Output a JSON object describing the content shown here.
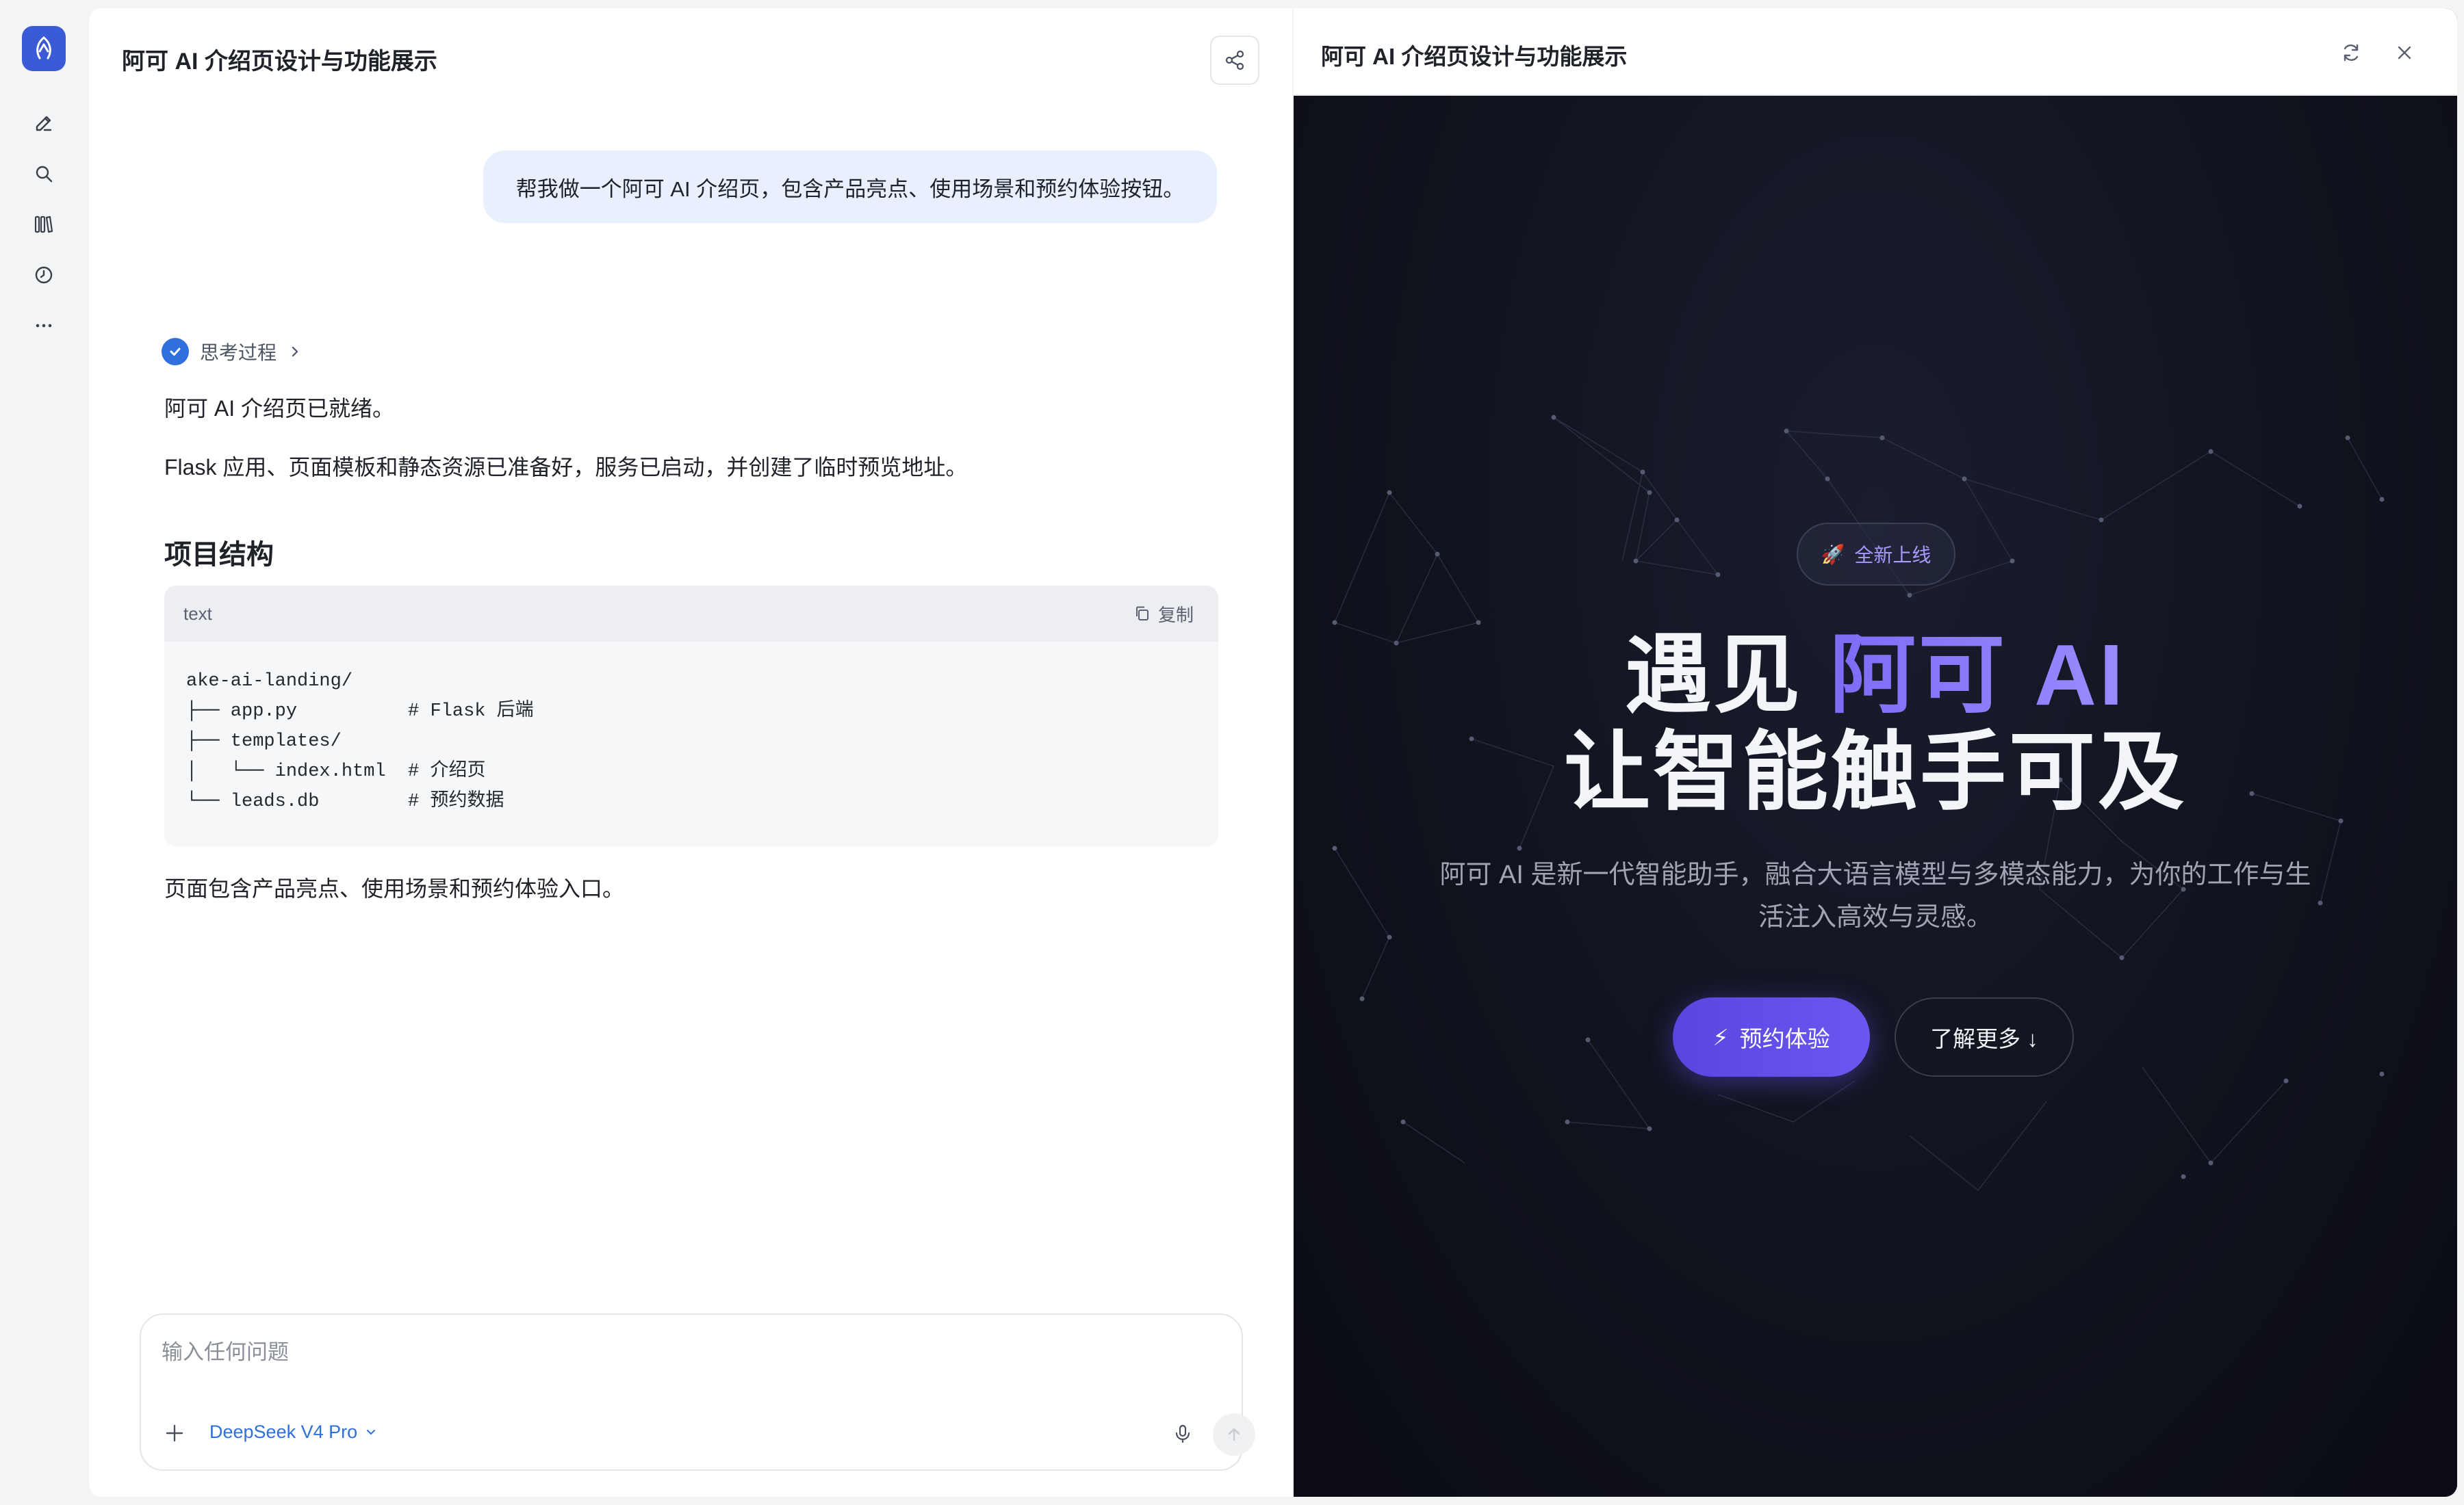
{
  "rail": {
    "items": [
      "new-chat",
      "search",
      "library",
      "history",
      "more"
    ]
  },
  "chat": {
    "title": "阿可 AI 介绍页设计与功能展示",
    "user_message": "帮我做一个阿可 AI 介绍页，包含产品亮点、使用场景和预约体验按钮。",
    "thinking_label": "思考过程",
    "reply_line1": "阿可 AI 介绍页已就绪。",
    "reply_line2": "Flask 应用、页面模板和静态资源已准备好，服务已启动，并创建了临时预览地址。",
    "section_heading": "项目结构",
    "code": {
      "lang": "text",
      "copy_label": "复制",
      "content": "ake-ai-landing/\n├── app.py          # Flask 后端\n├── templates/\n│   └── index.html  # 介绍页\n└── leads.db        # 预约数据"
    },
    "reply_line3": "页面包含产品亮点、使用场景和预约体验入口。"
  },
  "composer": {
    "placeholder": "输入任何问题",
    "model": "DeepSeek V4 Pro"
  },
  "preview": {
    "title": "阿可 AI 介绍页设计与功能展示",
    "badge": "全新上线",
    "hero_prefix": "遇见 ",
    "hero_accent": "阿可 AI",
    "hero_line2": "让智能触手可及",
    "subtitle": "阿可 AI 是新一代智能助手，融合大语言模型与多模态能力，为你的工作与生活注入高效与灵感。",
    "primary_cta": "预约体验",
    "secondary_cta": "了解更多 ↓"
  },
  "colors": {
    "accent_blue": "#2f6fde",
    "accent_purple": "#6b57f0",
    "preview_bg": "#0d0f1a"
  }
}
